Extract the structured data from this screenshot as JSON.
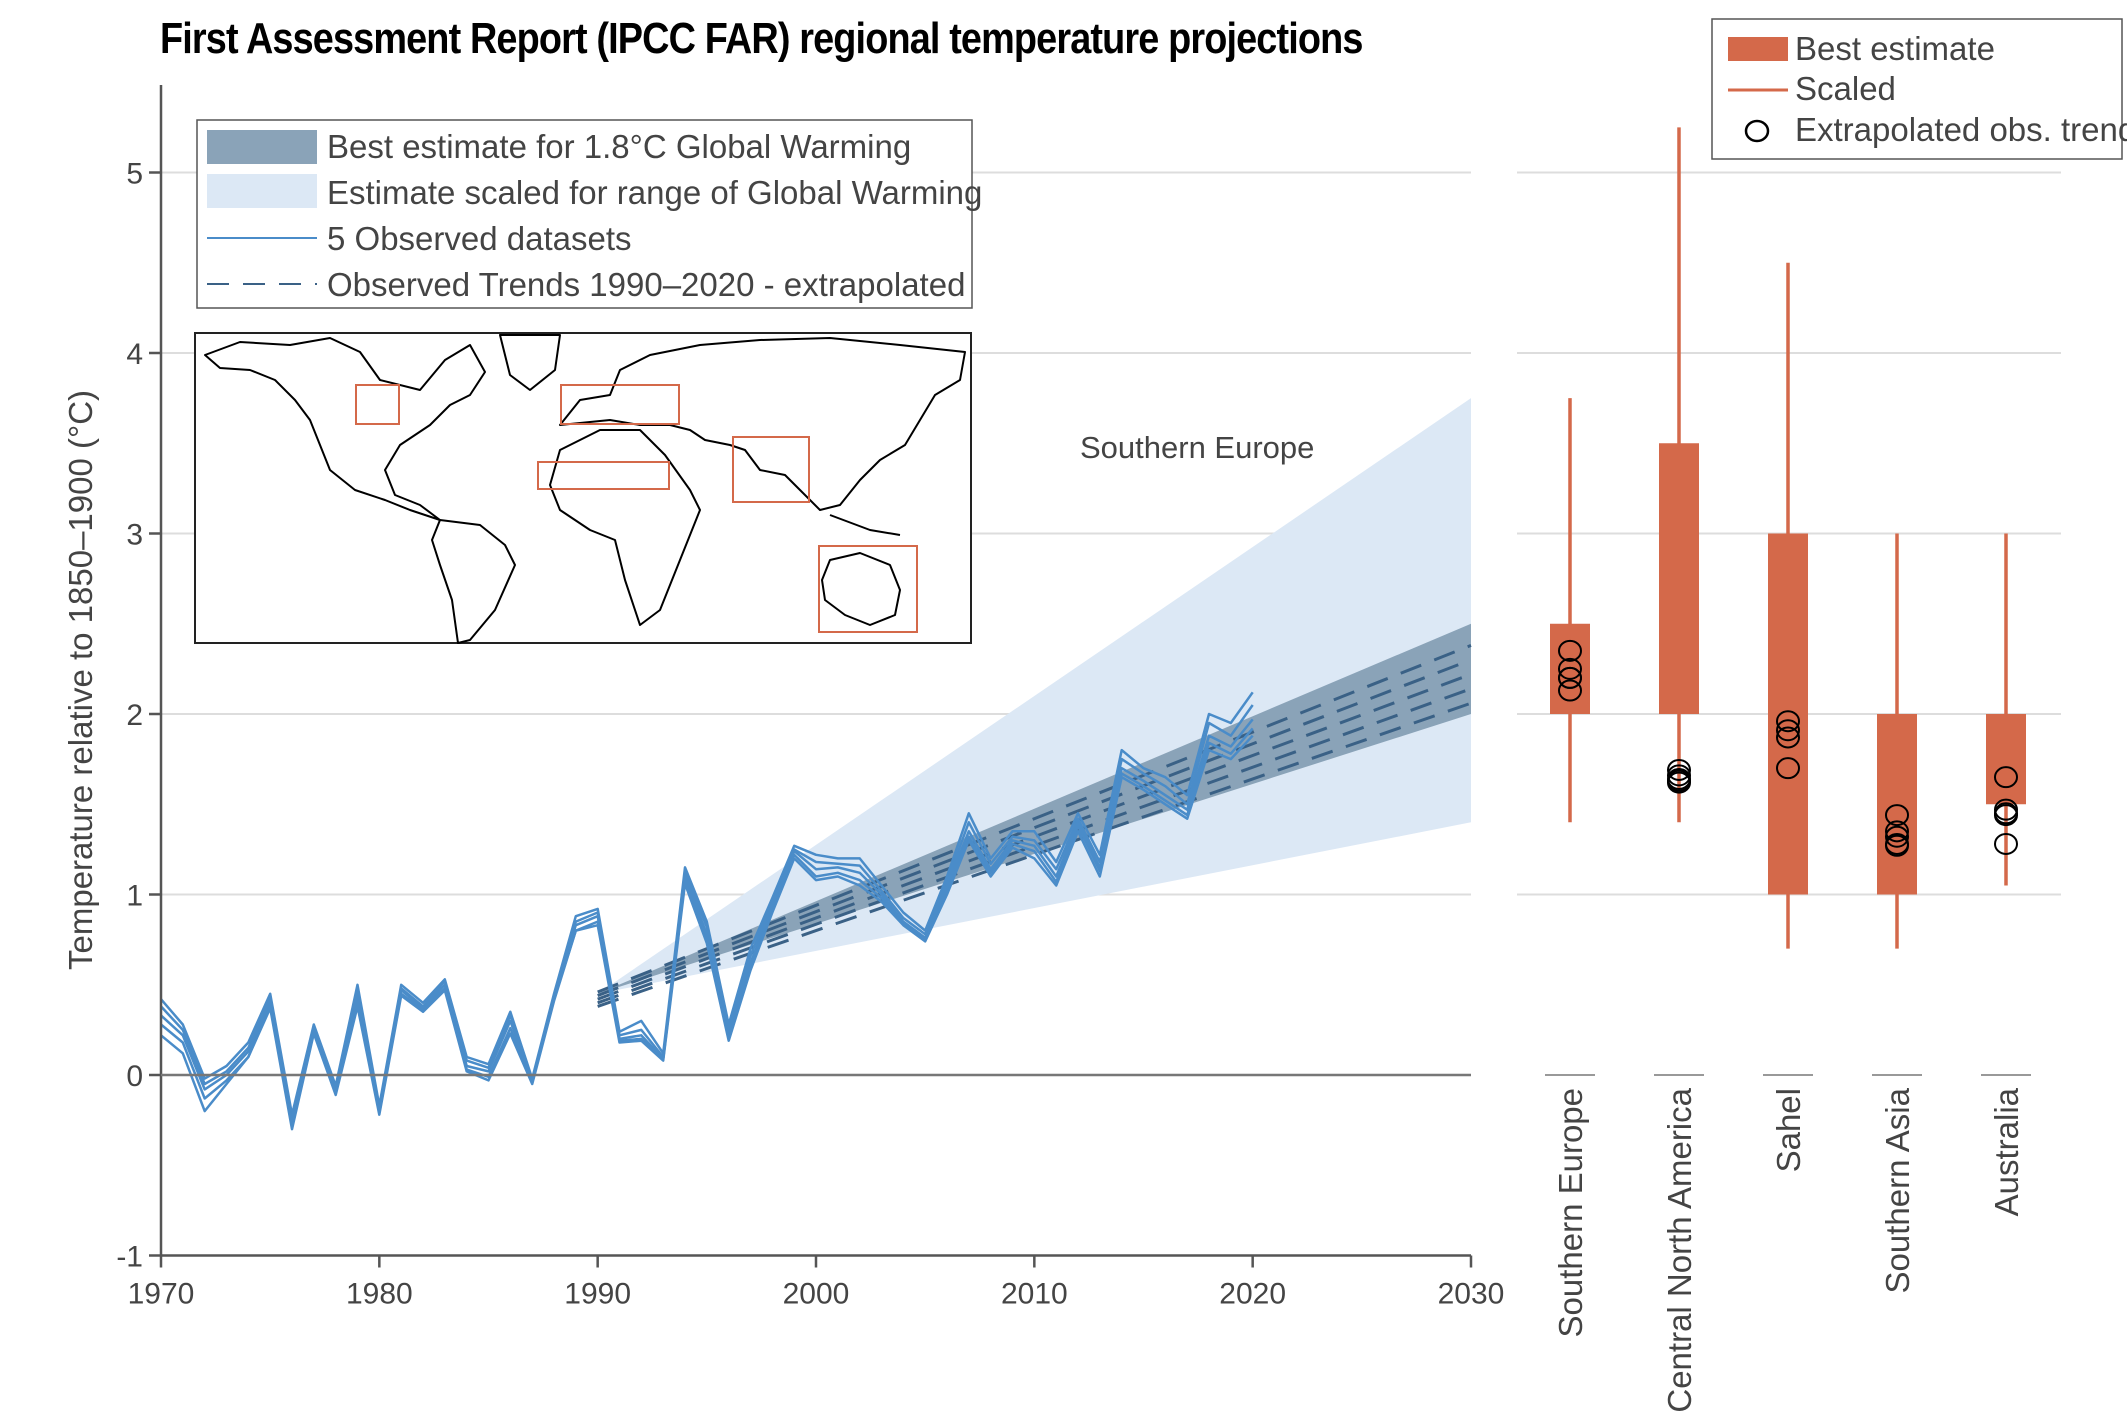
{
  "title": "First Assessment Report (IPCC FAR) regional temperature projections",
  "chart_data": [
    {
      "type": "line",
      "title": "First Assessment Report (IPCC FAR) regional temperature projections",
      "xlabel": "",
      "ylabel": "Temperature relative to 1850–1900 (°C)",
      "xlim": [
        1970,
        2030
      ],
      "ylim": [
        -1,
        5.5
      ],
      "xticks": [
        1970,
        1980,
        1990,
        2000,
        2010,
        2020,
        2030
      ],
      "yticks": [
        -1,
        0,
        1,
        2,
        3,
        4,
        5
      ],
      "grid": "horizontal",
      "annotation": "Southern Europe",
      "legend": {
        "placement": "top-left",
        "entries": [
          {
            "label": "Best estimate for 1.8°C Global Warming",
            "kind": "band",
            "color": "#8aa3b8"
          },
          {
            "label": "Estimate scaled for range of Global Warming",
            "kind": "band",
            "color": "#dce8f5"
          },
          {
            "label": "5 Observed datasets",
            "kind": "line",
            "color": "#4a8cc9"
          },
          {
            "label": "Observed Trends 1990–2020 - extrapolated",
            "kind": "dashed",
            "color": "#3a6186"
          }
        ]
      },
      "bands": [
        {
          "name": "Estimate scaled for range of Global Warming",
          "x": [
            1990,
            2030
          ],
          "lower": [
            0.45,
            1.4
          ],
          "upper": [
            0.45,
            3.75
          ],
          "color": "#dce8f5"
        },
        {
          "name": "Best estimate for 1.8°C Global Warming",
          "x": [
            1990,
            2030
          ],
          "lower": [
            0.45,
            2.0
          ],
          "upper": [
            0.45,
            2.5
          ],
          "color": "#8aa3b8"
        }
      ],
      "trends": [
        {
          "x": [
            1990,
            2030
          ],
          "y": [
            0.46,
            2.38
          ]
        },
        {
          "x": [
            1990,
            2030
          ],
          "y": [
            0.44,
            2.3
          ]
        },
        {
          "x": [
            1990,
            2030
          ],
          "y": [
            0.42,
            2.22
          ]
        },
        {
          "x": [
            1990,
            2030
          ],
          "y": [
            0.4,
            2.14
          ]
        },
        {
          "x": [
            1990,
            2030
          ],
          "y": [
            0.38,
            2.06
          ]
        }
      ],
      "x": [
        1970,
        1971,
        1972,
        1973,
        1974,
        1975,
        1976,
        1977,
        1978,
        1979,
        1980,
        1981,
        1982,
        1983,
        1984,
        1985,
        1986,
        1987,
        1988,
        1989,
        1990,
        1991,
        1992,
        1993,
        1994,
        1995,
        1996,
        1997,
        1998,
        1999,
        2000,
        2001,
        2002,
        2003,
        2004,
        2005,
        2006,
        2007,
        2008,
        2009,
        2010,
        2011,
        2012,
        2013,
        2014,
        2015,
        2016,
        2017,
        2018,
        2019,
        2020
      ],
      "series": [
        {
          "name": "Observed dataset 1",
          "values": [
            0.42,
            0.28,
            -0.02,
            0.05,
            0.18,
            0.45,
            -0.22,
            0.28,
            -0.06,
            0.5,
            -0.17,
            0.5,
            0.4,
            0.53,
            0.1,
            0.06,
            0.35,
            -0.02,
            0.45,
            0.88,
            0.92,
            0.24,
            0.3,
            0.12,
            1.15,
            0.85,
            0.28,
            0.7,
            0.98,
            1.27,
            1.22,
            1.2,
            1.2,
            1.05,
            0.9,
            0.8,
            1.1,
            1.45,
            1.2,
            1.35,
            1.35,
            1.18,
            1.45,
            1.22,
            1.8,
            1.7,
            1.65,
            1.55,
            2.0,
            1.95,
            2.12
          ]
        },
        {
          "name": "Observed dataset 2",
          "values": [
            0.38,
            0.25,
            -0.05,
            0.02,
            0.15,
            0.42,
            -0.25,
            0.27,
            -0.08,
            0.47,
            -0.19,
            0.48,
            0.38,
            0.52,
            0.08,
            0.04,
            0.33,
            -0.03,
            0.44,
            0.85,
            0.9,
            0.22,
            0.25,
            0.1,
            1.12,
            0.82,
            0.25,
            0.66,
            0.96,
            1.25,
            1.18,
            1.17,
            1.16,
            1.02,
            0.87,
            0.78,
            1.07,
            1.4,
            1.17,
            1.32,
            1.3,
            1.14,
            1.42,
            1.18,
            1.75,
            1.67,
            1.6,
            1.5,
            1.95,
            1.88,
            2.05
          ]
        },
        {
          "name": "Observed dataset 3",
          "values": [
            0.33,
            0.22,
            -0.08,
            0.0,
            0.13,
            0.4,
            -0.27,
            0.25,
            -0.1,
            0.43,
            -0.2,
            0.47,
            0.37,
            0.5,
            0.05,
            0.02,
            0.3,
            -0.03,
            0.43,
            0.83,
            0.88,
            0.2,
            0.22,
            0.09,
            1.1,
            0.78,
            0.22,
            0.62,
            0.94,
            1.24,
            1.14,
            1.15,
            1.12,
            1.0,
            0.85,
            0.76,
            1.05,
            1.35,
            1.14,
            1.3,
            1.27,
            1.1,
            1.4,
            1.15,
            1.7,
            1.63,
            1.55,
            1.47,
            1.88,
            1.82,
            1.97
          ]
        },
        {
          "name": "Observed dataset 4",
          "values": [
            0.28,
            0.18,
            -0.13,
            -0.03,
            0.1,
            0.38,
            -0.28,
            0.24,
            -0.1,
            0.4,
            -0.21,
            0.45,
            0.36,
            0.48,
            0.03,
            -0.01,
            0.26,
            -0.04,
            0.42,
            0.8,
            0.85,
            0.19,
            0.2,
            0.09,
            1.08,
            0.75,
            0.2,
            0.6,
            0.92,
            1.22,
            1.1,
            1.12,
            1.08,
            0.98,
            0.84,
            0.75,
            1.03,
            1.32,
            1.12,
            1.28,
            1.24,
            1.07,
            1.38,
            1.13,
            1.67,
            1.6,
            1.52,
            1.44,
            1.84,
            1.78,
            1.92
          ]
        },
        {
          "name": "Observed dataset 5",
          "values": [
            0.22,
            0.12,
            -0.2,
            -0.05,
            0.1,
            0.37,
            -0.3,
            0.23,
            -0.11,
            0.38,
            -0.22,
            0.44,
            0.35,
            0.47,
            0.02,
            -0.03,
            0.23,
            -0.05,
            0.41,
            0.8,
            0.83,
            0.18,
            0.19,
            0.08,
            1.06,
            0.73,
            0.19,
            0.58,
            0.9,
            1.2,
            1.08,
            1.1,
            1.05,
            0.96,
            0.83,
            0.74,
            1.0,
            1.3,
            1.1,
            1.26,
            1.2,
            1.05,
            1.35,
            1.1,
            1.65,
            1.58,
            1.5,
            1.42,
            1.8,
            1.75,
            1.88
          ]
        }
      ]
    },
    {
      "type": "box",
      "categories": [
        "Southern Europe",
        "Central North America",
        "Sahel",
        "Southern Asia",
        "Australia"
      ],
      "ylim": [
        -1,
        5.5
      ],
      "grid": "horizontal",
      "legend": {
        "placement": "top-right",
        "entries": [
          {
            "label": "Best estimate",
            "kind": "box",
            "color": "#d4694a"
          },
          {
            "label": "Scaled",
            "kind": "line",
            "color": "#d4694a"
          },
          {
            "label": "Extrapolated obs. trend",
            "kind": "circle",
            "color": "#000000"
          }
        ]
      },
      "boxes": [
        {
          "region": "Southern Europe",
          "best_low": 2.0,
          "best_high": 2.5,
          "scaled_low": 1.4,
          "scaled_high": 3.75,
          "obs_trend": [
            2.35,
            2.25,
            2.2,
            2.2,
            2.13
          ]
        },
        {
          "region": "Central North America",
          "best_low": 2.0,
          "best_high": 3.5,
          "scaled_low": 1.4,
          "scaled_high": 5.25,
          "obs_trend": [
            1.69,
            1.66,
            1.64,
            1.63,
            1.62
          ]
        },
        {
          "region": "Sahel",
          "best_low": 1.0,
          "best_high": 3.0,
          "scaled_low": 0.7,
          "scaled_high": 4.5,
          "obs_trend": [
            1.96,
            1.91,
            1.87,
            1.7
          ]
        },
        {
          "region": "Southern Asia",
          "best_low": 1.0,
          "best_high": 2.0,
          "scaled_low": 0.7,
          "scaled_high": 3.0,
          "obs_trend": [
            1.44,
            1.35,
            1.32,
            1.28,
            1.27
          ]
        },
        {
          "region": "Australia",
          "best_low": 1.5,
          "best_high": 2.0,
          "scaled_low": 1.05,
          "scaled_high": 3.0,
          "obs_trend": [
            1.65,
            1.47,
            1.45,
            1.44,
            1.28
          ]
        }
      ]
    }
  ],
  "map_inset": {
    "regions": [
      "Central North America",
      "Southern Europe",
      "Sahel",
      "Southern Asia",
      "Australia"
    ],
    "box_color": "#d4694a"
  },
  "colors": {
    "observed": "#4a8cc9",
    "trend": "#3a6186",
    "best_band": "#8aa3b8",
    "scaled_band": "#dce8f5",
    "box": "#d4694a",
    "grid": "#dddddd",
    "axis": "#555555"
  }
}
